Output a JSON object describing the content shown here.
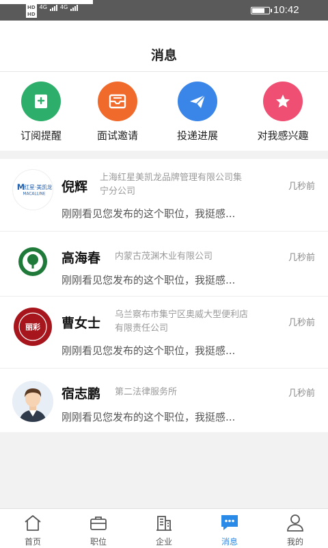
{
  "status_bar": {
    "network_1": "4G",
    "network_2": "4G",
    "time": "10:42"
  },
  "header": {
    "title": "消息"
  },
  "quick_actions": [
    {
      "label": "订阅提醒",
      "icon": "bookmark-plus-icon",
      "color": "#2dae6a"
    },
    {
      "label": "面试邀请",
      "icon": "mail-tray-icon",
      "color": "#f06a2c"
    },
    {
      "label": "投递进展",
      "icon": "paper-plane-icon",
      "color": "#3a86e8"
    },
    {
      "label": "对我感兴趣",
      "icon": "star-icon",
      "color": "#ef4f73"
    }
  ],
  "messages": [
    {
      "name": "倪辉",
      "company_line1": "上海红星美凯龙品牌管理有限公司集",
      "company_line2": "宁分公司",
      "time": "几秒前",
      "preview": "刚刚看见您发布的这个职位，我挺感...",
      "logo_text": "红星·美凯龙",
      "logo_sub": "MACALLINE"
    },
    {
      "name": "高海春",
      "company_line1": "内蒙古茂渊木业有限公司",
      "company_line2": "",
      "time": "几秒前",
      "preview": "刚刚看见您发布的这个职位，我挺感..."
    },
    {
      "name": "曹女士",
      "company_line1": "乌兰察布市集宁区奥威大型便利店",
      "company_line2": "有限责任公司",
      "time": "几秒前",
      "preview": "刚刚看见您发布的这个职位，我挺感...",
      "logo_text": "丽彩"
    },
    {
      "name": "宿志鹏",
      "company_line1": "第二法律服务所",
      "company_line2": "",
      "time": "几秒前",
      "preview": "刚刚看见您发布的这个职位，我挺感..."
    }
  ],
  "tabs": [
    {
      "label": "首页",
      "icon": "home-icon"
    },
    {
      "label": "职位",
      "icon": "briefcase-icon"
    },
    {
      "label": "企业",
      "icon": "building-icon"
    },
    {
      "label": "消息",
      "icon": "chat-bubble-icon",
      "active": true
    },
    {
      "label": "我的",
      "icon": "person-icon"
    }
  ],
  "colors": {
    "accent": "#2a8ae8",
    "background": "#f2f2f2"
  }
}
